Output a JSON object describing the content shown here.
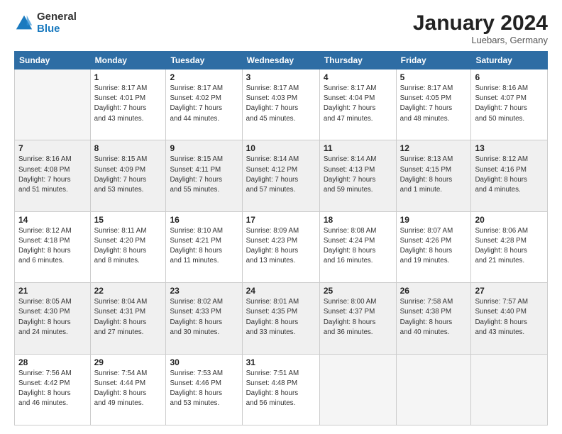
{
  "header": {
    "logo_general": "General",
    "logo_blue": "Blue",
    "month_year": "January 2024",
    "location": "Luebars, Germany"
  },
  "weekdays": [
    "Sunday",
    "Monday",
    "Tuesday",
    "Wednesday",
    "Thursday",
    "Friday",
    "Saturday"
  ],
  "weeks": [
    [
      {
        "day": "",
        "info": ""
      },
      {
        "day": "1",
        "info": "Sunrise: 8:17 AM\nSunset: 4:01 PM\nDaylight: 7 hours\nand 43 minutes."
      },
      {
        "day": "2",
        "info": "Sunrise: 8:17 AM\nSunset: 4:02 PM\nDaylight: 7 hours\nand 44 minutes."
      },
      {
        "day": "3",
        "info": "Sunrise: 8:17 AM\nSunset: 4:03 PM\nDaylight: 7 hours\nand 45 minutes."
      },
      {
        "day": "4",
        "info": "Sunrise: 8:17 AM\nSunset: 4:04 PM\nDaylight: 7 hours\nand 47 minutes."
      },
      {
        "day": "5",
        "info": "Sunrise: 8:17 AM\nSunset: 4:05 PM\nDaylight: 7 hours\nand 48 minutes."
      },
      {
        "day": "6",
        "info": "Sunrise: 8:16 AM\nSunset: 4:07 PM\nDaylight: 7 hours\nand 50 minutes."
      }
    ],
    [
      {
        "day": "7",
        "info": "Sunrise: 8:16 AM\nSunset: 4:08 PM\nDaylight: 7 hours\nand 51 minutes."
      },
      {
        "day": "8",
        "info": "Sunrise: 8:15 AM\nSunset: 4:09 PM\nDaylight: 7 hours\nand 53 minutes."
      },
      {
        "day": "9",
        "info": "Sunrise: 8:15 AM\nSunset: 4:11 PM\nDaylight: 7 hours\nand 55 minutes."
      },
      {
        "day": "10",
        "info": "Sunrise: 8:14 AM\nSunset: 4:12 PM\nDaylight: 7 hours\nand 57 minutes."
      },
      {
        "day": "11",
        "info": "Sunrise: 8:14 AM\nSunset: 4:13 PM\nDaylight: 7 hours\nand 59 minutes."
      },
      {
        "day": "12",
        "info": "Sunrise: 8:13 AM\nSunset: 4:15 PM\nDaylight: 8 hours\nand 1 minute."
      },
      {
        "day": "13",
        "info": "Sunrise: 8:12 AM\nSunset: 4:16 PM\nDaylight: 8 hours\nand 4 minutes."
      }
    ],
    [
      {
        "day": "14",
        "info": "Sunrise: 8:12 AM\nSunset: 4:18 PM\nDaylight: 8 hours\nand 6 minutes."
      },
      {
        "day": "15",
        "info": "Sunrise: 8:11 AM\nSunset: 4:20 PM\nDaylight: 8 hours\nand 8 minutes."
      },
      {
        "day": "16",
        "info": "Sunrise: 8:10 AM\nSunset: 4:21 PM\nDaylight: 8 hours\nand 11 minutes."
      },
      {
        "day": "17",
        "info": "Sunrise: 8:09 AM\nSunset: 4:23 PM\nDaylight: 8 hours\nand 13 minutes."
      },
      {
        "day": "18",
        "info": "Sunrise: 8:08 AM\nSunset: 4:24 PM\nDaylight: 8 hours\nand 16 minutes."
      },
      {
        "day": "19",
        "info": "Sunrise: 8:07 AM\nSunset: 4:26 PM\nDaylight: 8 hours\nand 19 minutes."
      },
      {
        "day": "20",
        "info": "Sunrise: 8:06 AM\nSunset: 4:28 PM\nDaylight: 8 hours\nand 21 minutes."
      }
    ],
    [
      {
        "day": "21",
        "info": "Sunrise: 8:05 AM\nSunset: 4:30 PM\nDaylight: 8 hours\nand 24 minutes."
      },
      {
        "day": "22",
        "info": "Sunrise: 8:04 AM\nSunset: 4:31 PM\nDaylight: 8 hours\nand 27 minutes."
      },
      {
        "day": "23",
        "info": "Sunrise: 8:02 AM\nSunset: 4:33 PM\nDaylight: 8 hours\nand 30 minutes."
      },
      {
        "day": "24",
        "info": "Sunrise: 8:01 AM\nSunset: 4:35 PM\nDaylight: 8 hours\nand 33 minutes."
      },
      {
        "day": "25",
        "info": "Sunrise: 8:00 AM\nSunset: 4:37 PM\nDaylight: 8 hours\nand 36 minutes."
      },
      {
        "day": "26",
        "info": "Sunrise: 7:58 AM\nSunset: 4:38 PM\nDaylight: 8 hours\nand 40 minutes."
      },
      {
        "day": "27",
        "info": "Sunrise: 7:57 AM\nSunset: 4:40 PM\nDaylight: 8 hours\nand 43 minutes."
      }
    ],
    [
      {
        "day": "28",
        "info": "Sunrise: 7:56 AM\nSunset: 4:42 PM\nDaylight: 8 hours\nand 46 minutes."
      },
      {
        "day": "29",
        "info": "Sunrise: 7:54 AM\nSunset: 4:44 PM\nDaylight: 8 hours\nand 49 minutes."
      },
      {
        "day": "30",
        "info": "Sunrise: 7:53 AM\nSunset: 4:46 PM\nDaylight: 8 hours\nand 53 minutes."
      },
      {
        "day": "31",
        "info": "Sunrise: 7:51 AM\nSunset: 4:48 PM\nDaylight: 8 hours\nand 56 minutes."
      },
      {
        "day": "",
        "info": ""
      },
      {
        "day": "",
        "info": ""
      },
      {
        "day": "",
        "info": ""
      }
    ]
  ]
}
